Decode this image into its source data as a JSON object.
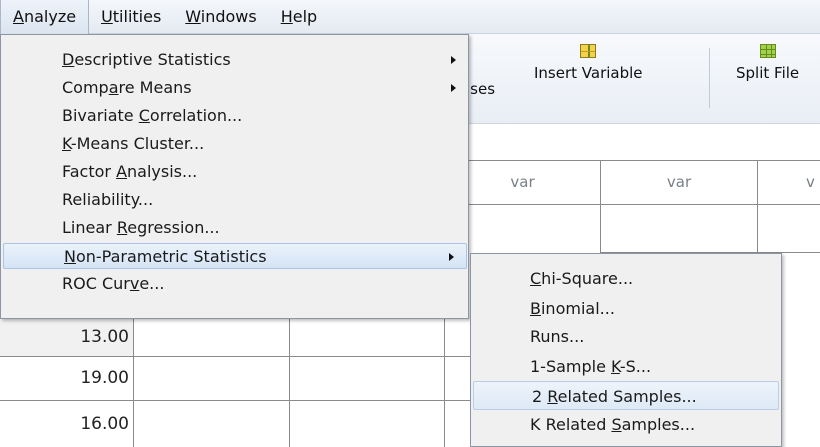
{
  "menubar": {
    "items": [
      {
        "prefix": "",
        "accel": "A",
        "rest": "nalyze"
      },
      {
        "prefix": "",
        "accel": "U",
        "rest": "tilities"
      },
      {
        "prefix": "",
        "accel": "W",
        "rest": "indows"
      },
      {
        "prefix": "",
        "accel": "H",
        "rest": "elp"
      }
    ]
  },
  "toolbar": {
    "cases_partial": "ıses",
    "insert_variable": "Insert Variable",
    "split_file": "Split File"
  },
  "grid": {
    "column_headers": [
      "var",
      "var",
      "v"
    ],
    "row_values": [
      "13.00",
      "19.00",
      "16.00"
    ]
  },
  "analyze_menu": {
    "items": [
      {
        "pre": "",
        "accel": "D",
        "post": "escriptive Statistics",
        "submenu": true
      },
      {
        "pre": "Comp",
        "accel": "a",
        "post": "re Means",
        "submenu": true
      },
      {
        "pre": "Bivariate ",
        "accel": "C",
        "post": "orrelation...",
        "submenu": false
      },
      {
        "pre": "",
        "accel": "K",
        "post": "-Means Cluster...",
        "submenu": false
      },
      {
        "pre": "Factor ",
        "accel": "A",
        "post": "nalysis...",
        "submenu": false
      },
      {
        "pre": "Reliability...",
        "accel": "",
        "post": "",
        "submenu": false
      },
      {
        "pre": "Linear ",
        "accel": "R",
        "post": "egression...",
        "submenu": false
      },
      {
        "pre": "",
        "accel": "N",
        "post": "on-Parametric Statistics",
        "submenu": true
      },
      {
        "pre": "ROC Cur",
        "accel": "v",
        "post": "e...",
        "submenu": false
      }
    ]
  },
  "nonparametric_submenu": {
    "items": [
      {
        "pre": "",
        "accel": "C",
        "post": "hi-Square..."
      },
      {
        "pre": "",
        "accel": "B",
        "post": "inomial..."
      },
      {
        "pre": "Runs...",
        "accel": "",
        "post": ""
      },
      {
        "pre": "1-Sample ",
        "accel": "K",
        "post": "-S..."
      },
      {
        "pre": "2 ",
        "accel": "R",
        "post": "elated Samples..."
      },
      {
        "pre": "K Related ",
        "accel": "S",
        "post": "amples..."
      }
    ]
  }
}
